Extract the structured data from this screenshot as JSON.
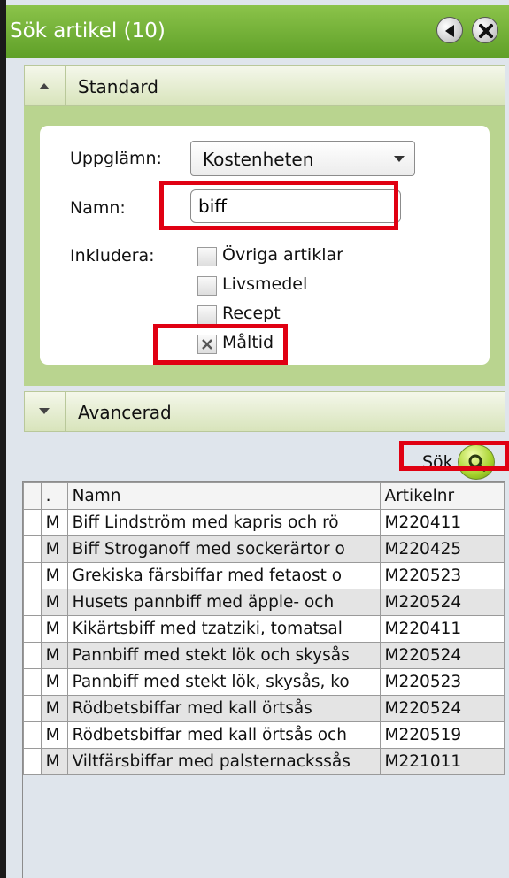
{
  "window": {
    "title": "Sök artikel (10)"
  },
  "standard": {
    "header": "Standard",
    "uppgl_label": "Uppglämn:",
    "uppgl_value": "Kostenheten",
    "namn_label": "Namn:",
    "namn_value": "biff",
    "inkludera_label": "Inkludera:",
    "options": [
      {
        "label": "Övriga artiklar",
        "checked": false
      },
      {
        "label": "Livsmedel",
        "checked": false
      },
      {
        "label": "Recept",
        "checked": false
      },
      {
        "label": "Måltid",
        "checked": true
      }
    ]
  },
  "advanced": {
    "header": "Avancerad"
  },
  "search_button": "Sök",
  "results": {
    "columns": [
      ".",
      "Namn",
      "Artikelnr"
    ],
    "rows": [
      {
        "type": "M",
        "name": "Biff Lindström med kapris och rö",
        "nr": "M220411"
      },
      {
        "type": "M",
        "name": "Biff Stroganoff med sockerärtor o",
        "nr": "M220425"
      },
      {
        "type": "M",
        "name": "Grekiska färsbiffar med fetaost o",
        "nr": "M220523"
      },
      {
        "type": "M",
        "name": "Husets pannbiff med äpple- och",
        "nr": "M220524"
      },
      {
        "type": "M",
        "name": "Kikärtsbiff med tzatziki, tomatsal",
        "nr": "M220411"
      },
      {
        "type": "M",
        "name": "Pannbiff med stekt lök och skysås",
        "nr": "M220524"
      },
      {
        "type": "M",
        "name": "Pannbiff med stekt lök, skysås, ko",
        "nr": "M220523"
      },
      {
        "type": "M",
        "name": "Rödbetsbiffar med kall örtsås",
        "nr": "M220524"
      },
      {
        "type": "M",
        "name": "Rödbetsbiffar med kall örtsås och",
        "nr": "M220519"
      },
      {
        "type": "M",
        "name": "Viltfärsbiffar med palsternackssås",
        "nr": "M221011"
      }
    ]
  }
}
